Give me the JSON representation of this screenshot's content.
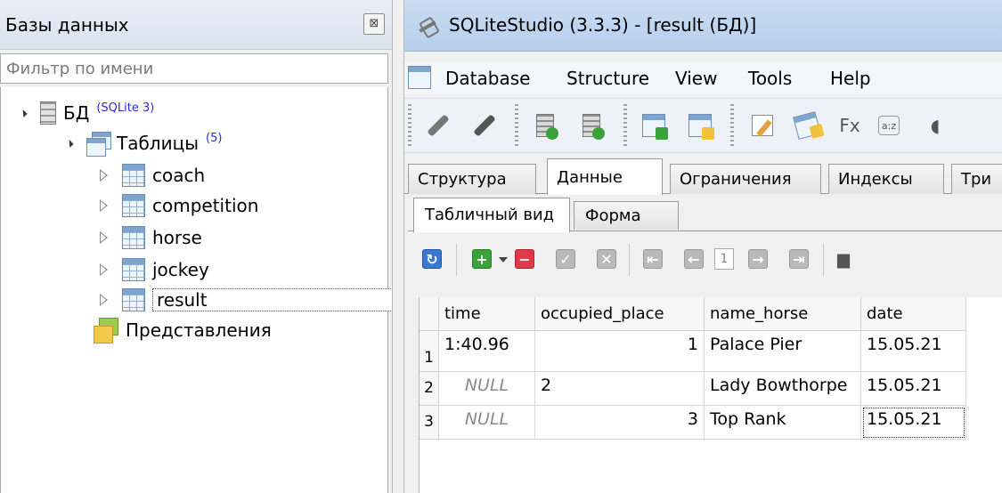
{
  "db_panel": {
    "title": "Базы данных",
    "close_glyph": "⊠",
    "filter_placeholder": "Фильтр по имени",
    "tree": {
      "database": {
        "label": "БД",
        "badge": "(SQLite 3)"
      },
      "tables_group": {
        "label": "Таблицы",
        "badge": "(5)"
      },
      "tables": [
        "coach",
        "competition",
        "horse",
        "jockey",
        "result"
      ],
      "selected_table": "result",
      "views_group": {
        "label": "Представления"
      }
    }
  },
  "window": {
    "title": "SQLiteStudio (3.3.3) - [result (БД)]"
  },
  "menu": [
    "Database",
    "Structure",
    "View",
    "Tools",
    "Help"
  ],
  "toolbar_icons": [
    "connect-icon",
    "disconnect-icon",
    "add-database-icon",
    "edit-database-icon",
    "create-table-icon",
    "edit-table-icon",
    "edit-icon",
    "import-icon",
    "function-icon",
    "collation-icon"
  ],
  "toolbar_fx_glyph": "Fx",
  "toolbar_az_glyph": "a:z",
  "tabs": [
    "Структура",
    "Данные",
    "Ограничения",
    "Индексы",
    "Три"
  ],
  "active_tab": "Данные",
  "subtabs": [
    "Табличный вид",
    "Форма"
  ],
  "active_subtab": "Табличный вид",
  "data_toolbar": {
    "page_number": "1",
    "glyphs": {
      "refresh": "↻",
      "add": "+",
      "delete": "−",
      "commit": "✓",
      "rollback": "✕",
      "first": "⇤",
      "prev": "←",
      "next": "→",
      "last": "⇥"
    }
  },
  "grid": {
    "columns": [
      "time",
      "occupied_place",
      "name_horse",
      "date"
    ],
    "rows": [
      {
        "n": "1",
        "time": "1:40.96",
        "occupied_place": "1",
        "name_horse": "Palace Pier",
        "date": "15.05.21"
      },
      {
        "n": "2",
        "time": "NULL",
        "occupied_place": "2",
        "name_horse": "Lady Bowthorpe",
        "date": "15.05.21"
      },
      {
        "n": "3",
        "time": "NULL",
        "occupied_place": "3",
        "name_horse": "Top Rank",
        "date": "15.05.21"
      }
    ]
  },
  "colors": {
    "title_bar": "#c9dcf2",
    "badge_blue": "#2a2ad6",
    "add_green": "#3aa23a",
    "delete_red": "#e03a4a",
    "refresh_blue": "#3a78d4"
  }
}
